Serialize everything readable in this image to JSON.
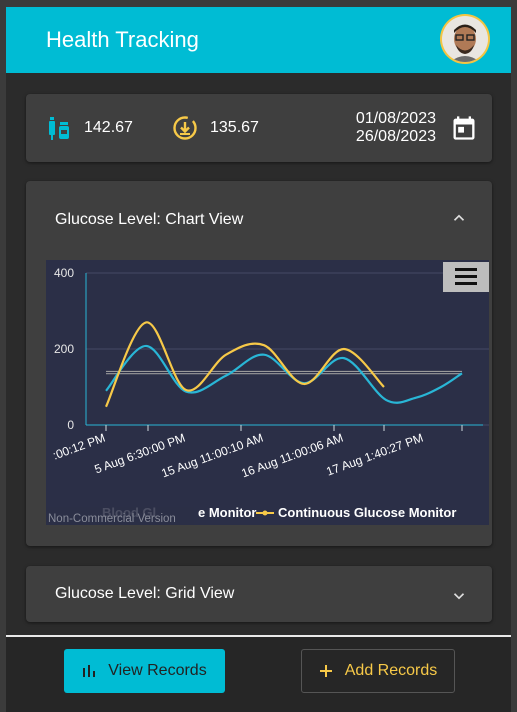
{
  "header": {
    "title": "Health Tracking"
  },
  "summary": {
    "blood_glucose_value": "142.67",
    "cgm_value": "135.67",
    "date_from": "01/08/2023",
    "date_to": "26/08/2023"
  },
  "chart_panel": {
    "title": "Glucose Level: Chart View"
  },
  "grid_panel": {
    "title": "Glucose Level: Grid View"
  },
  "footer": {
    "view_label": "View Records",
    "add_label": "Add Records"
  },
  "colors": {
    "header": "#00bcd4",
    "blood_glucose_line": "#29b6d6",
    "cgm_line": "#f7c948",
    "chart_bg": "#2b2f47"
  },
  "icons": {
    "blood": "syringe-vial-icon",
    "cgm": "download-circle-icon",
    "calendar": "calendar-icon",
    "expand_less": "chevron-up-icon",
    "expand_more": "chevron-down-icon",
    "view": "bar-chart-icon",
    "add": "plus-icon",
    "menu": "hamburger-icon"
  },
  "chart_data": {
    "type": "line",
    "y_ticks": [
      "400",
      "200",
      "0"
    ],
    "ylim": [
      0,
      400
    ],
    "x_labels": [
      ":00:12 PM",
      "5 Aug 6:30:00 PM",
      "15 Aug 11:00:10 AM",
      "16 Aug 11:00:06 AM",
      "17 Aug 1:40:27 PM"
    ],
    "series": [
      {
        "name": "Blood Glucose Monitor",
        "legend_visible": "Blood Gl",
        "color": "#29b6d6",
        "values": [
          90,
          208,
          88,
          130,
          185,
          110,
          176,
          66,
          72,
          100,
          136
        ]
      },
      {
        "name": "Continuous Glucose Monitor",
        "color": "#f7c948",
        "values": [
          48,
          270,
          92,
          185,
          210,
          108,
          200,
          100
        ]
      }
    ],
    "reference_lines": [
      141,
      135
    ],
    "watermark": "Non-Commercial Version",
    "legend_position": "bottom"
  }
}
